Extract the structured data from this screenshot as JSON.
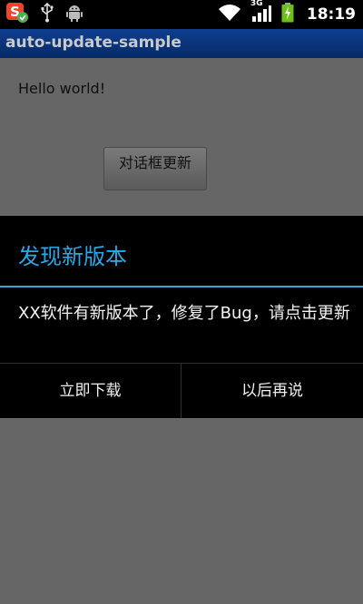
{
  "status_bar": {
    "time": "18:19",
    "network_type": "3G",
    "icons": [
      "sogou-input-icon",
      "usb-icon",
      "android-debug-icon",
      "wifi-icon",
      "signal-icon",
      "battery-charging-icon"
    ]
  },
  "app": {
    "title": "auto-update-sample",
    "hello_text": "Hello world!",
    "dialog_button_label": "对话框更新"
  },
  "dialog": {
    "title": "发现新版本",
    "message": "XX软件有新版本了，修复了Bug，请点击更新",
    "positive_label": "立即下载",
    "negative_label": "以后再说"
  },
  "colors": {
    "title_bar": "#0a3a86",
    "dialog_title": "#2aa8e6",
    "divider": "#3ba5d6",
    "background": "#666666"
  }
}
